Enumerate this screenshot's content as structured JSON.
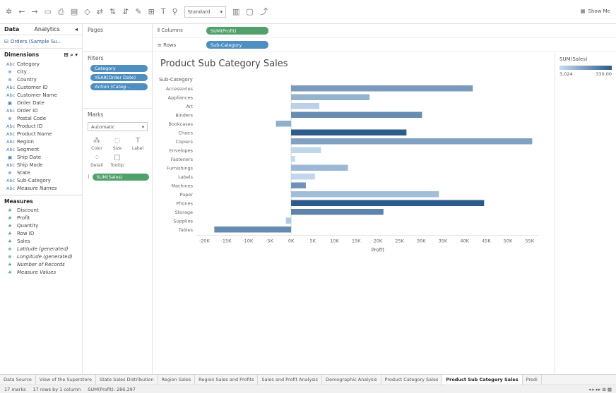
{
  "toolbar": {
    "fit_select": "Standard",
    "show_me": "Show Me"
  },
  "sidebar": {
    "tab_data": "Data",
    "tab_analytics": "Analytics",
    "datasource": "Orders (Sample Su...",
    "dimensions_title": "Dimensions",
    "dimensions": [
      {
        "icon": "Abc",
        "label": "Category"
      },
      {
        "icon": "geo",
        "label": "City"
      },
      {
        "icon": "geo",
        "label": "Country"
      },
      {
        "icon": "Abc",
        "label": "Customer ID"
      },
      {
        "icon": "Abc",
        "label": "Customer Name"
      },
      {
        "icon": "date",
        "label": "Order Date"
      },
      {
        "icon": "Abc",
        "label": "Order ID"
      },
      {
        "icon": "geo",
        "label": "Postal Code"
      },
      {
        "icon": "Abc",
        "label": "Product ID"
      },
      {
        "icon": "Abc",
        "label": "Product Name"
      },
      {
        "icon": "Abc",
        "label": "Region"
      },
      {
        "icon": "Abc",
        "label": "Segment"
      },
      {
        "icon": "date",
        "label": "Ship Date"
      },
      {
        "icon": "Abc",
        "label": "Ship Mode"
      },
      {
        "icon": "geo",
        "label": "State"
      },
      {
        "icon": "Abc",
        "label": "Sub-Category"
      },
      {
        "icon": "Abc",
        "label": "Measure Names",
        "italic": true
      }
    ],
    "measures_title": "Measures",
    "measures": [
      {
        "icon": "#",
        "label": "Discount"
      },
      {
        "icon": "#",
        "label": "Profit"
      },
      {
        "icon": "#",
        "label": "Quantity"
      },
      {
        "icon": "#",
        "label": "Row ID"
      },
      {
        "icon": "#",
        "label": "Sales"
      },
      {
        "icon": "geo",
        "label": "Latitude (generated)",
        "italic": true
      },
      {
        "icon": "geo",
        "label": "Longitude (generated)",
        "italic": true
      },
      {
        "icon": "#",
        "label": "Number of Records",
        "italic": true
      },
      {
        "icon": "#",
        "label": "Measure Values",
        "italic": true
      }
    ]
  },
  "pages": {
    "title": "Pages"
  },
  "filters": {
    "title": "Filters",
    "items": [
      "Category",
      "YEAR(Order Date)",
      "Action (Categ..."
    ]
  },
  "marks": {
    "title": "Marks",
    "type": "Automatic",
    "cells": [
      {
        "icon": "color",
        "label": "Color"
      },
      {
        "icon": "size",
        "label": "Size"
      },
      {
        "icon": "label",
        "label": "Label"
      },
      {
        "icon": "detail",
        "label": "Detail"
      },
      {
        "icon": "tooltip",
        "label": "Tooltip"
      }
    ],
    "pill": "SUM(Sales)"
  },
  "shelves": {
    "columns_label": "Columns",
    "columns_pill": "SUM(Profit)",
    "rows_label": "Rows",
    "rows_pill": "Sub-Category"
  },
  "view": {
    "title": "Product Sub Category Sales"
  },
  "legend": {
    "title": "SUM(Sales)",
    "min": "3,024",
    "max": "330,00"
  },
  "colors": {
    "light": "#c6dbef",
    "dark": "#2c5a8c",
    "pill_dim": "#4e8fbf",
    "pill_meas": "#52a06b"
  },
  "chart_data": {
    "type": "bar",
    "orientation": "horizontal",
    "title": "Product Sub Category Sales",
    "category_header": "Sub-Category",
    "xlabel": "Profit",
    "x_ticks": [
      "-20K",
      "-15K",
      "-10K",
      "-5K",
      "0K",
      "5K",
      "10K",
      "15K",
      "20K",
      "25K",
      "30K",
      "35K",
      "40K",
      "45K",
      "50K",
      "55K"
    ],
    "xlim": [
      -22000,
      57000
    ],
    "color_measure": "SUM(Sales)",
    "categories": [
      "Accessories",
      "Appliances",
      "Art",
      "Binders",
      "Bookcases",
      "Chairs",
      "Copiers",
      "Envelopes",
      "Fasteners",
      "Furnishings",
      "Labels",
      "Machines",
      "Paper",
      "Phones",
      "Storage",
      "Supplies",
      "Tables"
    ],
    "values": [
      41900,
      18100,
      6500,
      30200,
      -3500,
      26600,
      55600,
      6900,
      950,
      13100,
      5500,
      3400,
      34100,
      44500,
      21300,
      -1200,
      -17700
    ],
    "sales": [
      167000,
      107500,
      27100,
      203400,
      114900,
      328400,
      149500,
      16500,
      3000,
      91700,
      12500,
      189200,
      78500,
      330000,
      223800,
      46700,
      207000
    ]
  },
  "tabs": [
    "Data Source",
    "View of the Superstore",
    "State Sales Distribution",
    "Region Sales",
    "Region Sales and Profits",
    "Sales and Profit Analysis",
    "Demographic Analysis",
    "Product Category Sales",
    "Product Sub Category Sales",
    "Predi"
  ],
  "active_tab": "Product Sub Category Sales",
  "status": {
    "marks": "17 marks",
    "rows": "17 rows by 1 column",
    "sum": "SUM(Profit): 286,397"
  }
}
